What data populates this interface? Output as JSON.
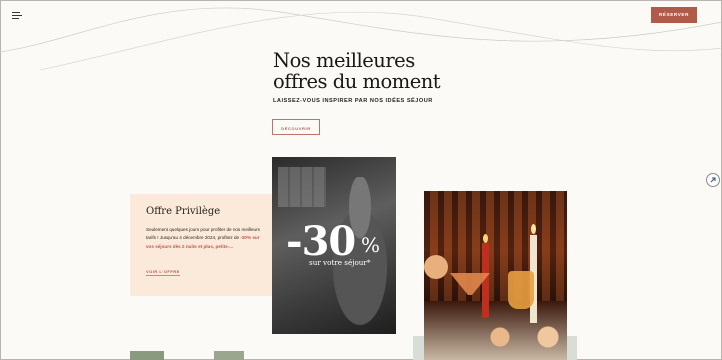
{
  "header": {
    "menu_icon": "hamburger-menu-icon",
    "reserve_label": "RÉSERVER",
    "accent": "#b05a49"
  },
  "hero": {
    "title_line1": "Nos meilleures",
    "title_line2": "offres du moment",
    "subtitle": "LAISSEZ-VOUS INSPIRER PAR NOS IDÉES SÉJOUR",
    "discover_label": "DÉCOUVRIR"
  },
  "offer_card": {
    "title": "Offre Privilège",
    "text_intro": "Seulement quelques jours pour profiter de nos meilleurs tarifs ! Jusqu'au 4 décembre 2024, profitez de ",
    "text_highlight": "-30% sur vos séjours dès 2 nuits et plus, petits-...",
    "link_label": "VOIR L'OFFRE",
    "background": "#fbe9d9"
  },
  "promo": {
    "percent": "-30",
    "percent_sign": "%",
    "caption": "sur votre séjour*"
  },
  "side_controls": {
    "scroll_icon": "arrow-up-right-icon"
  }
}
